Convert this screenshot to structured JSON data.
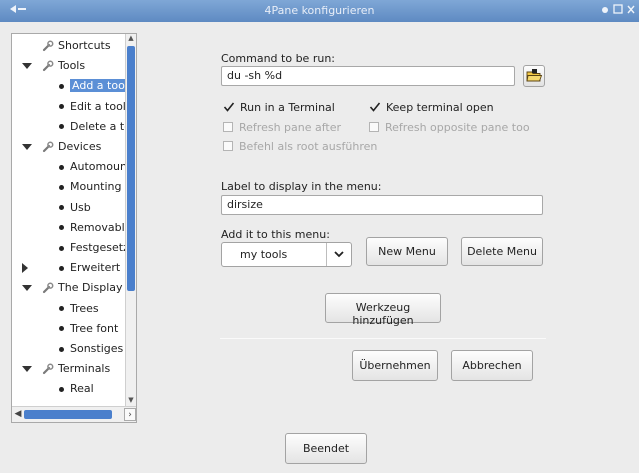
{
  "window": {
    "title": "4Pane konfigurieren"
  },
  "tree": {
    "items": [
      {
        "label": "Shortcuts",
        "level": 1,
        "kind": "wrench",
        "expander": "none"
      },
      {
        "label": "Tools",
        "level": 1,
        "kind": "wrench",
        "expander": "down"
      },
      {
        "label": "Add a tool",
        "level": 2,
        "kind": "bullet",
        "expander": "none",
        "selected": true
      },
      {
        "label": "Edit a tool",
        "level": 2,
        "kind": "bullet",
        "expander": "none"
      },
      {
        "label": "Delete a too",
        "level": 2,
        "kind": "bullet",
        "expander": "none"
      },
      {
        "label": "Devices",
        "level": 1,
        "kind": "wrench",
        "expander": "down"
      },
      {
        "label": "Automount",
        "level": 2,
        "kind": "bullet",
        "expander": "none"
      },
      {
        "label": "Mounting",
        "level": 2,
        "kind": "bullet",
        "expander": "none"
      },
      {
        "label": "Usb",
        "level": 2,
        "kind": "bullet",
        "expander": "none"
      },
      {
        "label": "Removable",
        "level": 2,
        "kind": "bullet",
        "expander": "none"
      },
      {
        "label": "Festgesetzt",
        "level": 2,
        "kind": "bullet",
        "expander": "none"
      },
      {
        "label": "Erweitert",
        "level": 2,
        "kind": "bullet",
        "expander": "right"
      },
      {
        "label": "The Display",
        "level": 1,
        "kind": "wrench",
        "expander": "down"
      },
      {
        "label": "Trees",
        "level": 2,
        "kind": "bullet",
        "expander": "none"
      },
      {
        "label": "Tree font",
        "level": 2,
        "kind": "bullet",
        "expander": "none"
      },
      {
        "label": "Sonstiges",
        "level": 2,
        "kind": "bullet",
        "expander": "none"
      },
      {
        "label": "Terminals",
        "level": 1,
        "kind": "wrench",
        "expander": "down"
      },
      {
        "label": "Real",
        "level": 2,
        "kind": "bullet",
        "expander": "none"
      }
    ]
  },
  "form": {
    "command_label": "Command to be run:",
    "command_value": "du -sh %d",
    "run_in_terminal": {
      "label": "Run in a Terminal",
      "checked": true,
      "enabled": true
    },
    "keep_terminal_open": {
      "label": "Keep terminal open",
      "checked": true,
      "enabled": true
    },
    "refresh_pane_after": {
      "label": "Refresh pane after",
      "checked": false,
      "enabled": false
    },
    "refresh_opposite_pane": {
      "label": "Refresh opposite pane too",
      "checked": false,
      "enabled": false
    },
    "run_as_root": {
      "label": "Befehl als root ausführen",
      "checked": false,
      "enabled": false
    },
    "menu_label_caption": "Label to display in the menu:",
    "menu_label_value": "dirsize",
    "add_to_menu_caption": "Add it to this menu:",
    "menu_selected": "my tools",
    "new_menu_button": "New Menu",
    "delete_menu_button": "Delete Menu",
    "add_tool_button": "Werkzeug hinzufügen",
    "apply_button": "Übernehmen",
    "cancel_button": "Abbrechen"
  },
  "footer": {
    "finish_button": "Beendet"
  },
  "colors": {
    "titlebar": "#6b94c9",
    "selection": "#5b8fd6",
    "scroll_thumb": "#4a7fcc"
  }
}
